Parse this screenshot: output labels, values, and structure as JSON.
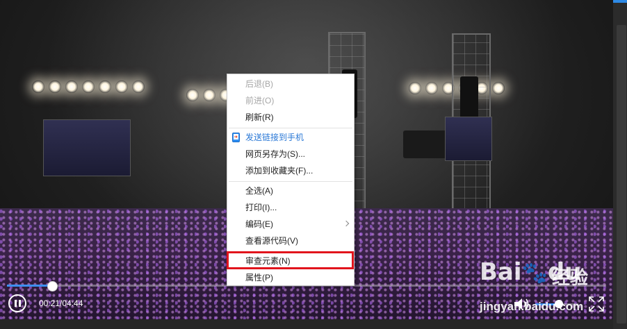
{
  "player": {
    "current_time": "00:21",
    "duration": "04:44",
    "time_display": "00:21/04:44",
    "progress_fraction": 0.074,
    "volume_fraction": 0.55
  },
  "context_menu": {
    "items": [
      {
        "label": "后退(B)",
        "state": "disabled"
      },
      {
        "label": "前进(O)",
        "state": "disabled"
      },
      {
        "label": "刷新(R)",
        "state": "normal"
      },
      {
        "label": "发送链接到手机",
        "state": "link",
        "icon": "phone-send-icon"
      },
      {
        "label": "网页另存为(S)...",
        "state": "normal"
      },
      {
        "label": "添加到收藏夹(F)...",
        "state": "normal"
      },
      {
        "label": "全选(A)",
        "state": "normal"
      },
      {
        "label": "打印(I)...",
        "state": "normal"
      },
      {
        "label": "编码(E)",
        "state": "normal",
        "submenu": true
      },
      {
        "label": "查看源代码(V)",
        "state": "normal"
      },
      {
        "label": "审查元素(N)",
        "state": "highlighted"
      },
      {
        "label": "属性(P)",
        "state": "normal"
      }
    ]
  },
  "watermark": {
    "logo": "Bai",
    "logo_suffix": "du",
    "product": "经验",
    "url": "jingyan.baidu.com"
  },
  "colors": {
    "accent_blue": "#3d8ff0",
    "highlight_red": "#e1141c",
    "link_blue": "#2a78d6",
    "disabled_gray": "#a6a6a6"
  }
}
